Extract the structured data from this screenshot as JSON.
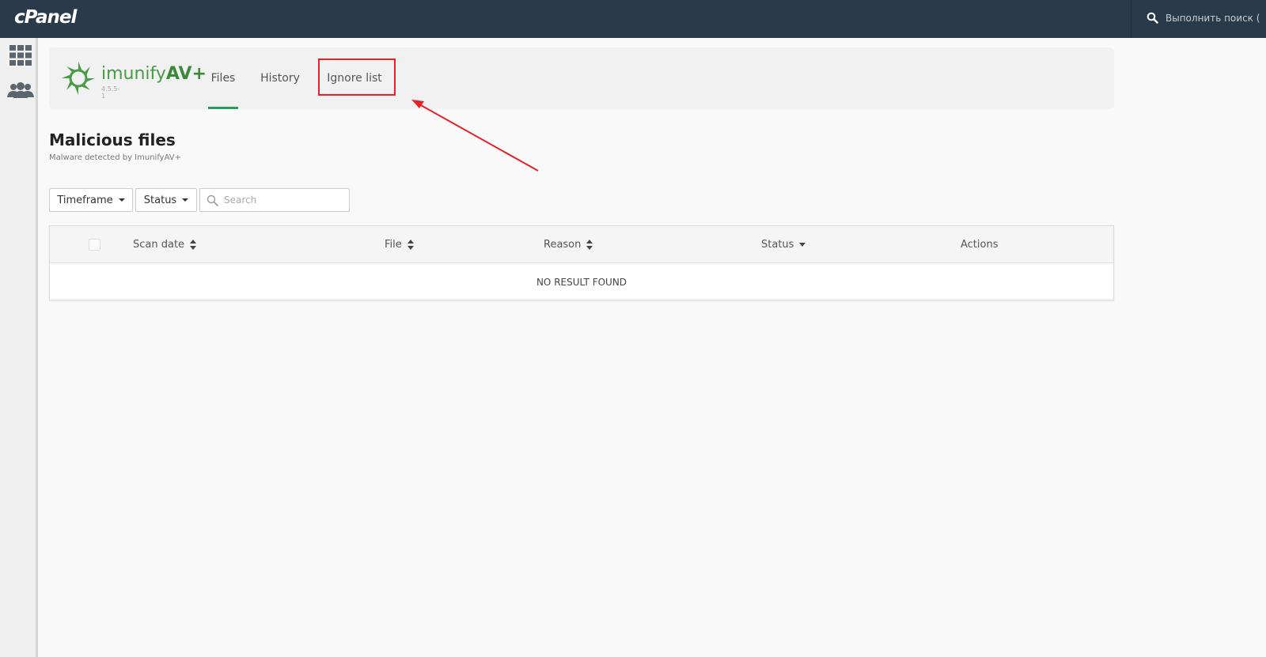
{
  "topbar": {
    "logo": "cPanel",
    "search_placeholder": "Выполнить поиск ("
  },
  "rail": {
    "icons": [
      "apps-grid-icon",
      "users-icon"
    ]
  },
  "plugin": {
    "name_prefix": "imunify",
    "name_suffix": "AV+",
    "version": "4.5.5-1",
    "brand_color": "#4a9a48"
  },
  "nav": {
    "tabs": [
      {
        "label": "Files",
        "active": true
      },
      {
        "label": "History",
        "active": false
      },
      {
        "label": "Ignore list",
        "active": false
      }
    ],
    "active_color": "#2a9b58",
    "highlight_color": "#e8202a"
  },
  "page": {
    "title": "Malicious files",
    "subtitle": "Malware detected by ImunifyAV+"
  },
  "filters": {
    "timeframe_label": "Timeframe",
    "status_label": "Status",
    "search_placeholder": "Search"
  },
  "table": {
    "columns": [
      {
        "label": "Scan date",
        "sort": "both"
      },
      {
        "label": "File",
        "sort": "both"
      },
      {
        "label": "Reason",
        "sort": "both"
      },
      {
        "label": "Status",
        "sort": "down"
      },
      {
        "label": "Actions",
        "sort": "none"
      }
    ],
    "empty_message": "NO RESULT FOUND"
  }
}
